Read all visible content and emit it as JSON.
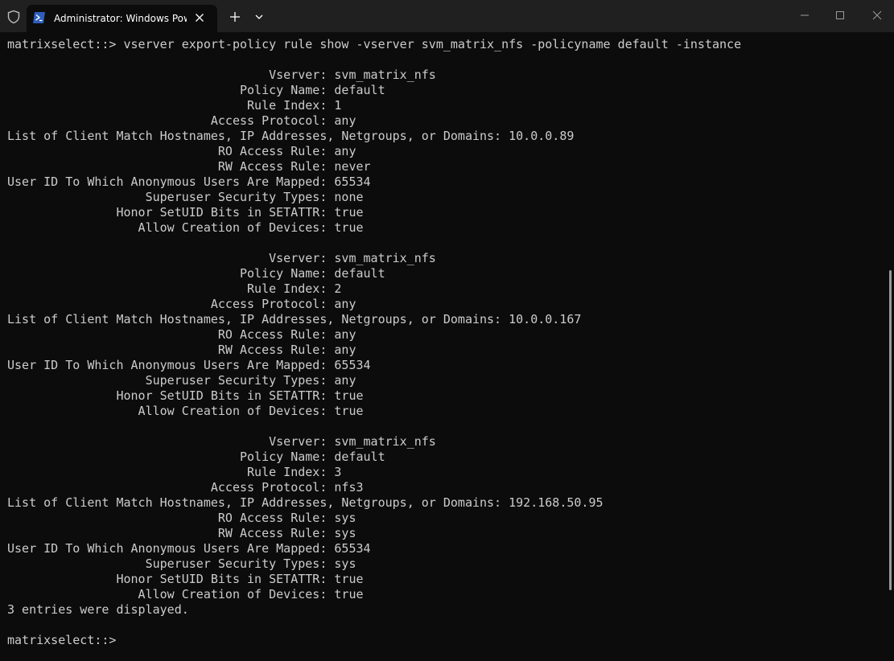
{
  "window": {
    "tab_title": "Administrator: Windows PowerShell",
    "shield_icon": "shield-icon",
    "powershell_icon": "powershell-icon",
    "close_tab_icon": "close-icon",
    "new_tab_icon": "plus-icon",
    "dropdown_icon": "chevron-down-icon",
    "minimize_icon": "minimize-icon",
    "maximize_icon": "maximize-icon",
    "close_window_icon": "close-icon"
  },
  "colors": {
    "background": "#0c0c0c",
    "text": "#cccccc",
    "titlebar": "#202020",
    "powershell_blue": "#2d5dbd"
  },
  "terminal": {
    "text": "matrixselect::> vserver export-policy rule show -vserver svm_matrix_nfs -policyname default -instance\n\n                                    Vserver: svm_matrix_nfs\n                                Policy Name: default\n                                 Rule Index: 1\n                            Access Protocol: any\nList of Client Match Hostnames, IP Addresses, Netgroups, or Domains: 10.0.0.89\n                             RO Access Rule: any\n                             RW Access Rule: never\nUser ID To Which Anonymous Users Are Mapped: 65534\n                   Superuser Security Types: none\n               Honor SetUID Bits in SETATTR: true\n                  Allow Creation of Devices: true\n\n                                    Vserver: svm_matrix_nfs\n                                Policy Name: default\n                                 Rule Index: 2\n                            Access Protocol: any\nList of Client Match Hostnames, IP Addresses, Netgroups, or Domains: 10.0.0.167\n                             RO Access Rule: any\n                             RW Access Rule: any\nUser ID To Which Anonymous Users Are Mapped: 65534\n                   Superuser Security Types: any\n               Honor SetUID Bits in SETATTR: true\n                  Allow Creation of Devices: true\n\n                                    Vserver: svm_matrix_nfs\n                                Policy Name: default\n                                 Rule Index: 3\n                            Access Protocol: nfs3\nList of Client Match Hostnames, IP Addresses, Netgroups, or Domains: 192.168.50.95\n                             RO Access Rule: sys\n                             RW Access Rule: sys\nUser ID To Which Anonymous Users Are Mapped: 65534\n                   Superuser Security Types: sys\n               Honor SetUID Bits in SETATTR: true\n                  Allow Creation of Devices: true\n3 entries were displayed.\n\nmatrixselect::> "
  }
}
